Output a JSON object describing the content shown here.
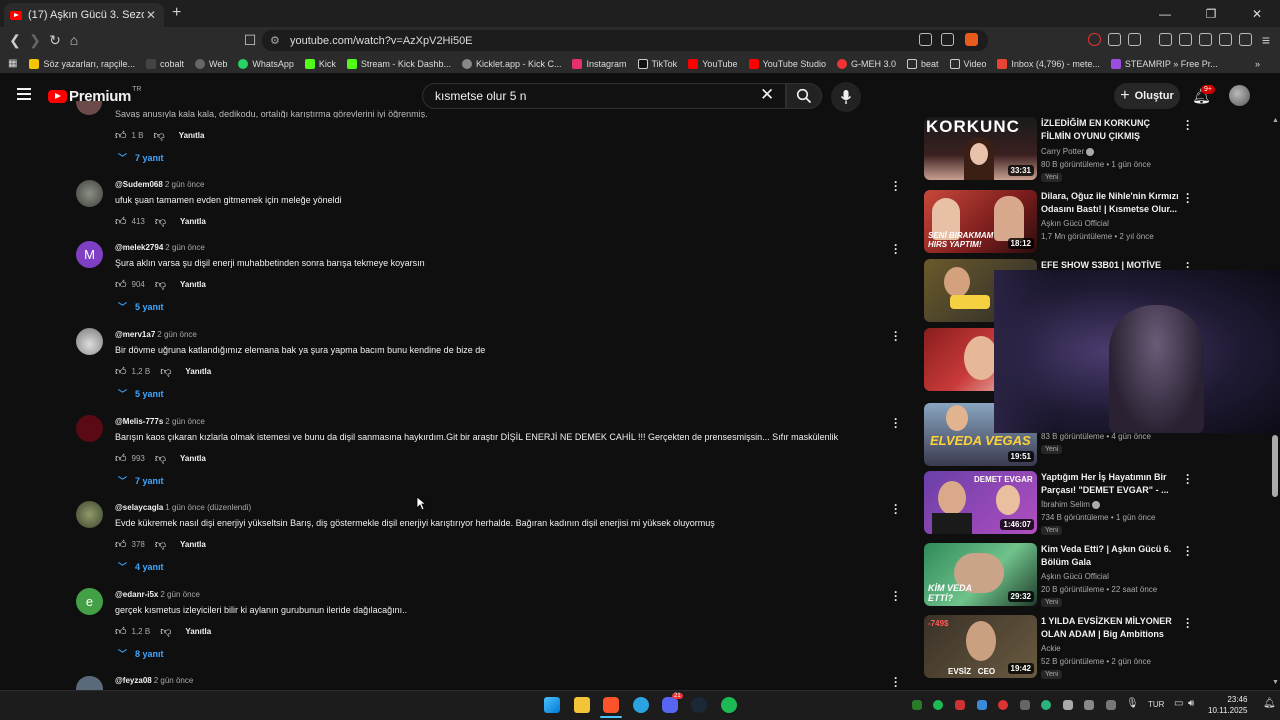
{
  "browser": {
    "tab_title": "(17) Aşkın Gücü 3. Sezon 5. Bölü",
    "url": "youtube.com/watch?v=AzXpV2Hi50E",
    "bookmarks": [
      "Söz yazarları, rapçile...",
      "cobalt",
      "Web",
      "WhatsApp",
      "Kick",
      "Stream - Kick Dashb...",
      "Kicklet.app - Kick C...",
      "Instagram",
      "TikTok",
      "YouTube",
      "YouTube Studio",
      "G-MEH 3.0",
      "beat",
      "Video",
      "Inbox (4,796) - mete...",
      "STEAMRIP » Free Pr..."
    ]
  },
  "header": {
    "logo_text": "Premium",
    "logo_region": "TR",
    "search_value": "kısmetse olur 5 n",
    "create_label": "Oluştur",
    "notif_count": "9+"
  },
  "comments": {
    "partial_text": "Savaş anusıyla kala kala, dedikodu, ortalığı karıştırma görevlerini iyi öğrenmiş.",
    "partial_likes": "1 B",
    "partial_replies": "7 yanıt",
    "reply_label": "Yanıtla",
    "items": [
      {
        "user": "@Sudem068",
        "date": "2 gün önce",
        "text": "ufuk şuan tamamen evden gitmemek için meleğe yöneldi",
        "likes": "413",
        "replies": ""
      },
      {
        "user": "@melek2794",
        "date": "2 gün önce",
        "text": "Şura aklın varsa şu dişil enerji muhabbetinden sonra barışa tekmeye koyarsın",
        "likes": "904",
        "replies": "5 yanıt",
        "initial": "M"
      },
      {
        "user": "@merv1a7",
        "date": "2 gün önce",
        "text": "Bir dövme uğruna katlandığımız elemana bak ya şura yapma bacım bunu kendine de bize de",
        "likes": "1,2 B",
        "replies": "5 yanıt"
      },
      {
        "user": "@Melis-777s",
        "date": "2 gün önce",
        "text": "Barışın kaos çıkaran kızlarla olmak istemesi ve bunu da dişil sanmasına haykırdım.Git bir araştır DİŞİL ENERJİ NE DEMEK CAHİL !!! Gerçekten de prensesmişsin... Sıfır maskülenlik",
        "likes": "993",
        "replies": "7 yanıt"
      },
      {
        "user": "@selaycagla",
        "date": "1 gün önce (düzenlendi)",
        "text": "Evde kükremek nasıl dişi enerjiyi yükseltsin Barış, diş göstermekle dişil enerjiyi karıştırıyor herhalde. Bağıran kadının dişil enerjisi mi yüksek oluyormuş",
        "likes": "378",
        "replies": "4 yanıt"
      },
      {
        "user": "@edanr-i5x",
        "date": "2 gün önce",
        "text": "gerçek kısmetus izleyicileri bilir ki aylanın gurubunun ileride dağılacağını..",
        "likes": "1,2 B",
        "replies": "8 yanıt",
        "initial": "e"
      },
      {
        "user": "@feyza08",
        "date": "2 gün önce",
        "text": "",
        "likes": "",
        "replies": ""
      }
    ]
  },
  "sidebar": {
    "videos": [
      {
        "title": "İZLEDİĞİM EN KORKUNÇ FİLMİN OYUNU ÇIKMIŞ",
        "channel": "Carry Potter",
        "meta": "80 B görüntüleme • 1 gün önce",
        "badge": "Yeni",
        "duration": "33:31",
        "overlay": "KORKUNC"
      },
      {
        "title": "Dilara, Oğuz ile Nihle'nin Kırmızı Odasını Bastı! | Kısmetse Olur...",
        "channel": "Aşkın Gücü Official",
        "meta": "1,7 Mn görüntüleme • 2 yıl önce",
        "badge": "",
        "duration": "18:12",
        "overlay": "SENİ BIRAKMAM HIRS YAPTIM!"
      },
      {
        "title": "EFE SHOW S3B01 | MOTİVE",
        "channel": "",
        "meta": "",
        "badge": "",
        "duration": "",
        "overlay": ""
      },
      {
        "title": "",
        "channel": "",
        "meta": "",
        "badge": "",
        "duration": "",
        "overlay": ""
      },
      {
        "title": "",
        "channel": "",
        "meta": "83 B görüntüleme • 4 gün önce",
        "badge": "Yeni",
        "duration": "19:51",
        "overlay": "ELVEDA VEGAS"
      },
      {
        "title": "Yaptığım Her İş Hayatımın Bir Parçası! \"DEMET EVGAR\" - ...",
        "channel": "İbrahim Selim",
        "meta": "734 B görüntüleme • 1 gün önce",
        "badge": "Yeni",
        "duration": "1:46:07",
        "overlay": "DEMET EVGAR"
      },
      {
        "title": "Kim Veda Etti? | Aşkın Gücü 6. Bölüm Gala",
        "channel": "Aşkın Gücü Official",
        "meta": "20 B görüntüleme • 22 saat önce",
        "badge": "Yeni",
        "duration": "29:32",
        "overlay": "KİM VEDA ETTİ?"
      },
      {
        "title": "1 YILDA EVSİZKEN MİLYONER OLAN ADAM | Big Ambitions",
        "channel": "Ackie",
        "meta": "52 B görüntüleme • 2 gün önce",
        "badge": "Yeni",
        "duration": "19:42",
        "overlay": "EVSİZ   CEO"
      }
    ]
  },
  "taskbar": {
    "lang": "TUR",
    "time": "23:46",
    "date": "10.11.2025",
    "discord_badge": "21"
  },
  "colors": {
    "background": "#0f0f0f",
    "link_blue": "#3ea6ff",
    "yt_red": "#ff0000"
  }
}
